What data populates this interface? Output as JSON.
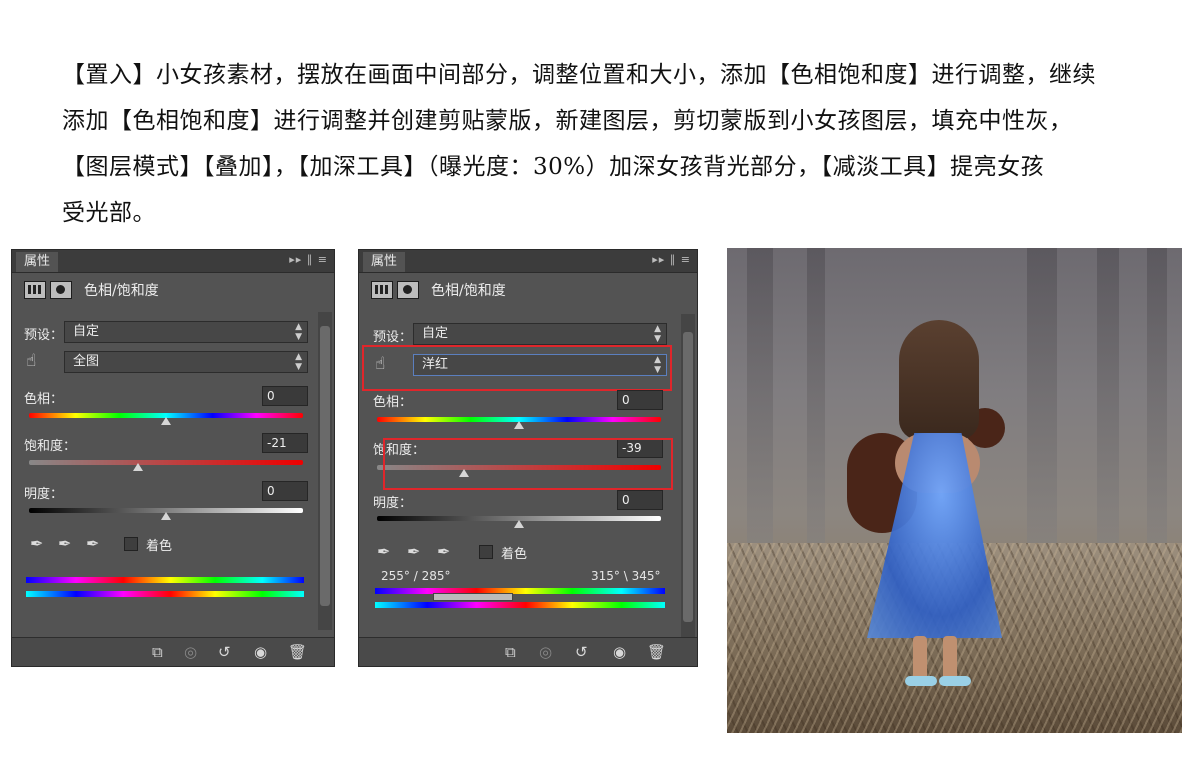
{
  "instructions": {
    "lines": [
      "【置入】小女孩素材，摆放在画面中间部分，调整位置和大小，添加【色相饱和度】进行调整，继续",
      "添加【色相饱和度】进行调整并创建剪贴蒙版，新建图层，剪切蒙版到小女孩图层，填充中性灰，",
      "【图层模式】【叠加】，【加深工具】（曝光度：30%）加深女孩背光部分，【减淡工具】提亮女孩",
      "受光部。"
    ]
  },
  "panel1": {
    "tab_title": "属性",
    "adjustment_name": "色相/饱和度",
    "preset_label": "预设：",
    "preset_value": "自定",
    "channel_value": "全图",
    "hue_label": "色相：",
    "hue_value": "0",
    "saturation_label": "饱和度：",
    "saturation_value": "-21",
    "lightness_label": "明度：",
    "lightness_value": "0",
    "colorize_label": "着色"
  },
  "panel2": {
    "tab_title": "属性",
    "adjustment_name": "色相/饱和度",
    "preset_label": "预设：",
    "preset_value": "自定",
    "channel_value": "洋红",
    "hue_label": "色相：",
    "hue_value": "0",
    "saturation_label": "饱和度：",
    "saturation_value": "-39",
    "lightness_label": "明度：",
    "lightness_value": "0",
    "colorize_label": "着色",
    "range_left": "255° / 285°",
    "range_right": "315° \\ 345°"
  },
  "colors": {
    "panel_bg": "#535353",
    "highlight_box": "#e0262b"
  },
  "icons": {
    "adjustment": "hue-saturation-icon",
    "mask": "mask-icon",
    "on_image_adjust": "hand-target-icon",
    "eyedroppers": [
      "eyedropper-icon",
      "eyedropper-plus-icon",
      "eyedropper-minus-icon"
    ],
    "bottom": [
      "clip-to-layer-icon",
      "view-previous-icon",
      "reset-icon",
      "visibility-eye-icon",
      "trash-icon"
    ]
  }
}
